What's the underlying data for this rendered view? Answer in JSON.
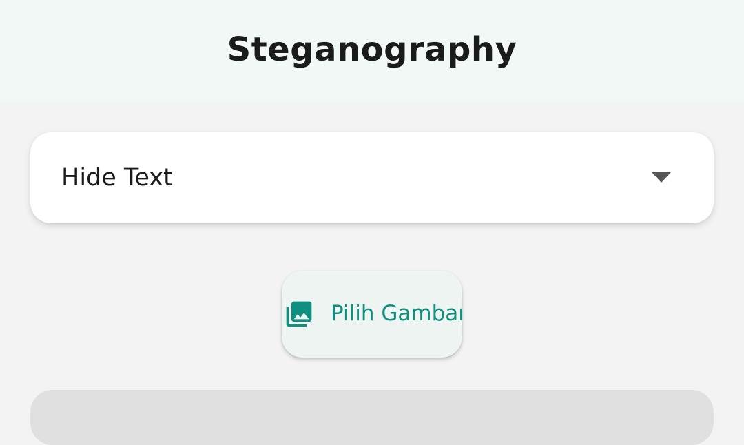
{
  "app_bar": {
    "title": "Steganography"
  },
  "mode_select": {
    "selected": "Hide Text",
    "icon": "arrow-drop-down-icon"
  },
  "pick_image_button": {
    "label": "Pilih Gambar",
    "icon": "photo-library-icon",
    "color": "#0e8f80"
  },
  "colors": {
    "app_bar_bg": "#f2f8f6",
    "page_bg": "#f3f3f3",
    "accent": "#0e8f80"
  }
}
